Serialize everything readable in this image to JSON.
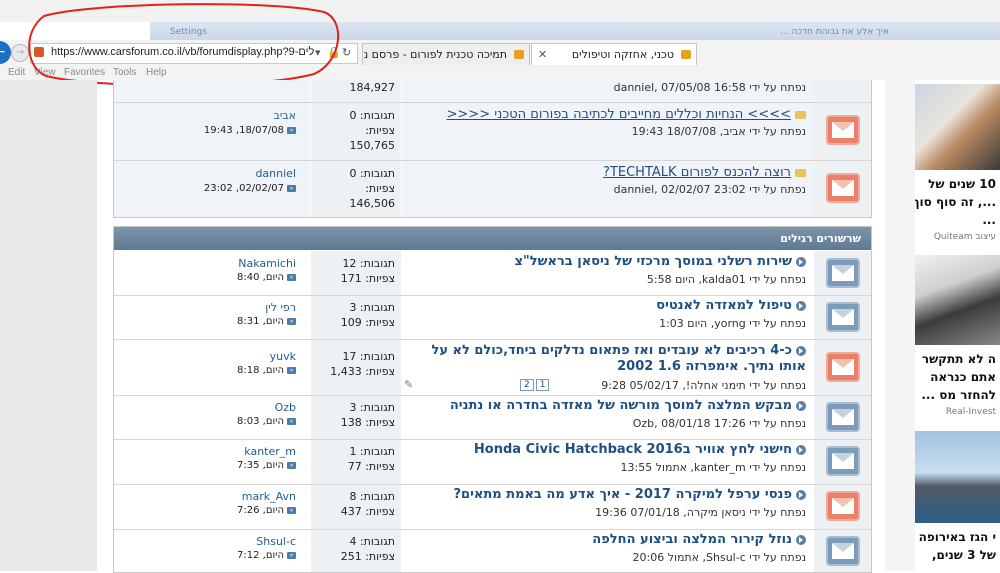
{
  "browser": {
    "url": "https://www.carsforum.co.il/vb/forumdisplay.php?9-לים",
    "faded_tab_label": "Settings",
    "faded_tab_right": "איך אלע את גבוהת חדכה ...",
    "tabs": [
      {
        "label": "טכני, אחזקה וטיפולים",
        "active": true
      },
      {
        "label": "תמיכה טכנית לפורום - פרסם נו...",
        "active": false
      }
    ],
    "menu": [
      "Edit",
      "View",
      "Favorites",
      "Tools",
      "Help"
    ]
  },
  "top_rows": [
    {
      "title": "",
      "meta": "נפתח על ידי danniel, 07/05/08 16:58",
      "replies": "",
      "views": "184,927",
      "last_user": "",
      "last_date": ""
    },
    {
      "title": ">>>> הנחיות וכללים מחייבים לכתיבה בפורום הטכני <<<<",
      "meta": "נפתח על ידי אביב, 18/07/08 19:43",
      "replies": "תגובות: 0",
      "views_label": "צפיות:",
      "views": "150,765",
      "last_user": "אביב",
      "last_date": "18/07/08, 19:43"
    },
    {
      "title": "רוצה להכנס לפורום TECHTALK?",
      "meta": "נפתח על ידי danniel, 02/02/07 23:02",
      "replies": "תגובות: 0",
      "views_label": "צפיות:",
      "views": "146,506",
      "last_user": "danniel",
      "last_date": "02/02/07, 23:02"
    }
  ],
  "section": {
    "title": "שרשורים רגילים"
  },
  "threads": [
    {
      "title": "שירות רשלני במוסך מרכזי של ניסאן בראשל\"צ",
      "meta": "נפתח על ידי kalda01, היום 5:58",
      "replies": "תגובות: 12",
      "views": "צפיות: 171",
      "last_user": "Nakamichi",
      "last_date": "היום, 8:40",
      "icon": "blue"
    },
    {
      "title": "טיפול למאזדה לאנטיס",
      "meta": "נפתח על ידי yorng, היום 1:03",
      "replies": "תגובות: 3",
      "views": "צפיות: 109",
      "last_user": "רפי לין",
      "last_date": "היום, 8:31",
      "icon": "blue"
    },
    {
      "title": "כ-4 רכיבים לא עובדים ואז פתאום נדלקים ביחד,כולם לא על אותו נתיך. אימפרזה 1.6 2002",
      "meta": "נפתח על ידי תימני אחלה!, 05/02/17 9:28",
      "replies": "תגובות: 17",
      "views": "צפיות: 1,433",
      "last_user": "yuvk",
      "last_date": "היום, 8:18",
      "icon": "orange",
      "pages": [
        "1",
        "2"
      ]
    },
    {
      "title": "מבקש המלצה למוסך מורשה של מאזדה בחדרה או נתניה",
      "meta": "נפתח על ידי Ozb, 08/01/18 17:26",
      "replies": "תגובות: 3",
      "views": "צפיות: 138",
      "last_user": "Ozb",
      "last_date": "היום, 8:03",
      "icon": "blue"
    },
    {
      "title": "חישני לחץ אוויר בHonda Civic Hatchback 2016",
      "meta": "נפתח על ידי kanter_m, אתמול 13:55",
      "replies": "תגובות: 1",
      "views": "צפיות: 77",
      "last_user": "kanter_m",
      "last_date": "היום, 7:35",
      "icon": "blue"
    },
    {
      "title": "פנסי ערפל למיקרה 2017 - איך אדע מה באמת מתאים?",
      "meta": "נפתח על ידי ניסאן מיקרה, 07/01/18 19:36",
      "replies": "תגובות: 8",
      "views": "צפיות: 437",
      "last_user": "mark_Avn",
      "last_date": "היום, 7:26",
      "icon": "orange"
    },
    {
      "title": "נוזל קירור המלצה וביצוע החלפה",
      "meta": "נפתח על ידי Shsul-c, אתמול 20:06",
      "replies": "תגובות: 4",
      "views": "צפיות: 251",
      "last_user": "Shsul-c",
      "last_date": "היום, 7:12",
      "icon": "blue"
    }
  ],
  "ads": [
    {
      "text1": "10 שנים של",
      "text2": "..., זה סוף סוף",
      "text3": "...",
      "source": "Quiteam עיצוב"
    },
    {
      "text1": "ה לא תתקשר",
      "text2": "אתם כנראה",
      "text3": "להחזר מס ...",
      "source": "Real-Invest"
    },
    {
      "text1": "י הגז באירופה",
      "text2": "של 3 שנים,",
      "text3": ""
    }
  ],
  "colors": {
    "accent_red": "#e2231a",
    "section_header": "#6a849c",
    "link_blue": "#1f4f82"
  }
}
